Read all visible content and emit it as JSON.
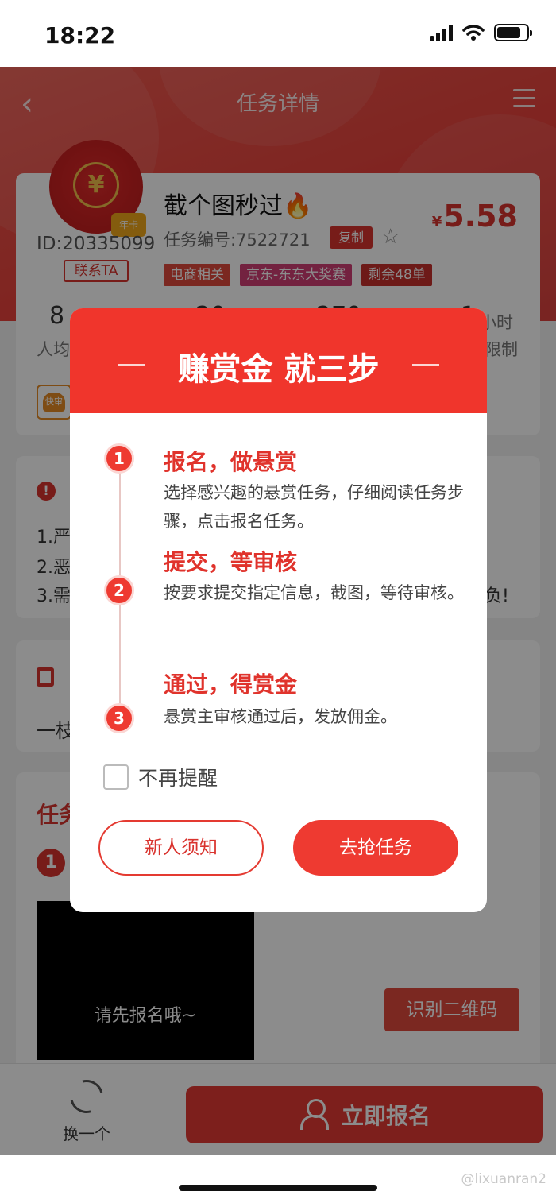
{
  "status_bar": {
    "time": "18:22"
  },
  "nav": {
    "title": "任务详情",
    "back_icon": "chevron-left-icon",
    "menu_icon": "hamburger-icon"
  },
  "task": {
    "title": "截个图秒过🔥",
    "id_label": "ID:20335099",
    "contact": "联系TA",
    "badge": "年卡",
    "task_no": "任务编号:7522721",
    "copy": "复制",
    "price_symbol": "¥",
    "price": "5.58",
    "tags": [
      "电商相关",
      "京东-东东大奖赛",
      "剩余48单"
    ],
    "stats_visible": [
      "8",
      "人均",
      "20",
      "270",
      "1",
      "小时",
      "限制"
    ],
    "fast_badge": "快审"
  },
  "notice_card": {
    "lines": [
      "1.严",
      "2.恶",
      "3.需"
    ],
    "tail": "负!"
  },
  "desc_card": {
    "text": "一枝"
  },
  "steps_card": {
    "heading": "任务",
    "step_no": "1",
    "placeholder": "请先报名哦~",
    "qr_button": "识别二维码"
  },
  "bottom": {
    "swap": "换一个",
    "signup": "立即报名"
  },
  "watermark": "@lixuanran2",
  "modal": {
    "title": "赚赏金 就三步",
    "steps": [
      {
        "num": "1",
        "title": "报名，做悬赏",
        "desc": "选择感兴趣的悬赏任务，仔细阅读任务步骤，点击报名任务。"
      },
      {
        "num": "2",
        "title": "提交，等审核",
        "desc": "按要求提交指定信息，截图，等待审核。"
      },
      {
        "num": "3",
        "title": "通过，得赏金",
        "desc": "悬赏主审核通过后，发放佣金。"
      }
    ],
    "remind_label": "不再提醒",
    "remind_checked": false,
    "btn_notice": "新人须知",
    "btn_go": "去抢任务"
  },
  "colors": {
    "brand": "#e8403a",
    "modal_red": "#f0352c",
    "overlay": "rgba(0,0,0,0.45)"
  }
}
